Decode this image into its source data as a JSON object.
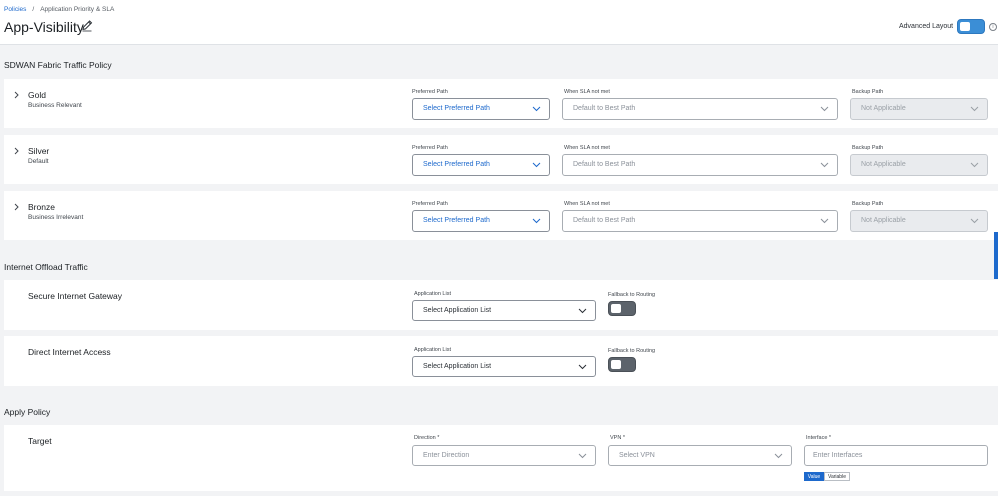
{
  "breadcrumb": {
    "root": "Policies",
    "separator": "/",
    "current": "Application Priority & SLA"
  },
  "page": {
    "title": "App-Visibility"
  },
  "header": {
    "advanced_layout_label": "Advanced Layout",
    "advanced_layout_on": true
  },
  "sdwan": {
    "title": "SDWAN Fabric Traffic Policy",
    "rows": [
      {
        "name": "Gold",
        "subtitle": "Business Relevant"
      },
      {
        "name": "Silver",
        "subtitle": "Default"
      },
      {
        "name": "Bronze",
        "subtitle": "Business Irrelevant"
      }
    ],
    "preferred_label": "Preferred Path",
    "preferred_value": "Select Preferred Path",
    "sla_label": "When SLA not met",
    "sla_value": "Default to Best Path",
    "backup_label": "Backup Path",
    "backup_value": "Not Applicable"
  },
  "offload": {
    "title": "Internet Offload Traffic",
    "rows": [
      {
        "name": "Secure Internet Gateway"
      },
      {
        "name": "Direct Internet Access"
      }
    ],
    "app_list_label": "Application List",
    "app_list_value": "Select Application List",
    "fallback_label": "Fallback to Routing"
  },
  "apply": {
    "title": "Apply Policy",
    "target_label": "Target",
    "direction_label": "Direction *",
    "direction_placeholder": "Enter Direction",
    "vpn_label": "VPN *",
    "vpn_placeholder": "Select VPN",
    "interface_label": "Interface *",
    "interface_placeholder": "Enter Interfaces",
    "value_option": "Value",
    "variable_option": "Variable"
  },
  "colors": {
    "accent": "#1d69cc",
    "toggle_on": "#3b8ed6",
    "toggle_off": "#5c636b"
  }
}
